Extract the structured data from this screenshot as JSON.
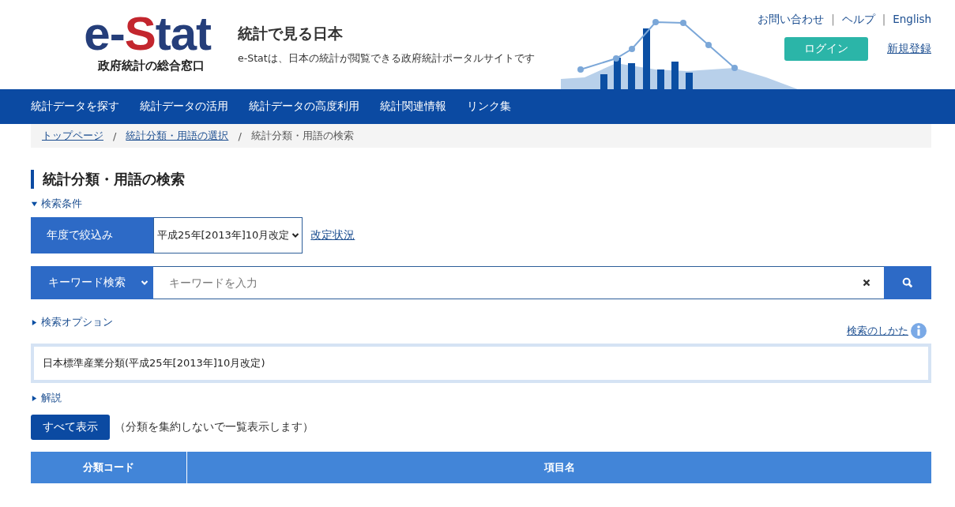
{
  "header": {
    "logo": {
      "text_primary": "e-",
      "text_accent": "S",
      "text_rest": "tat",
      "subtitle": "政府統計の総合窓口"
    },
    "tagline_title": "統計で見る日本",
    "tagline": "e-Statは、日本の統計が閲覧できる政府統計ポータルサイトです",
    "utility_links": [
      "お問い合わせ",
      "ヘルプ",
      "English"
    ],
    "utility_separator": "|",
    "login_button": "ログイン",
    "register_link": "新規登録"
  },
  "nav": [
    {
      "label": "統計データを探す"
    },
    {
      "label": "統計データの活用"
    },
    {
      "label": "統計データの高度利用"
    },
    {
      "label": "統計関連情報"
    },
    {
      "label": "リンク集"
    }
  ],
  "breadcrumb": [
    {
      "label": "トップページ",
      "link": true
    },
    {
      "label": "統計分類・用語の選択",
      "link": true
    },
    {
      "label": "統計分類・用語の検索",
      "link": false
    }
  ],
  "breadcrumb_separator": "/",
  "page_title": "統計分類・用語の検索",
  "search_conditions": {
    "label": "検索条件",
    "expanded": true
  },
  "year_filter": {
    "label": "年度で絞込み",
    "value": "平成25年[2013年]10月改定",
    "link": "改定状況"
  },
  "keyword_search": {
    "mode": "キーワード検索",
    "placeholder": "キーワードを入力"
  },
  "search_options": {
    "label": "検索オプション",
    "expanded": false
  },
  "search_help_link": "検索のしかた",
  "classification": "日本標準産業分類(平成25年[2013年]10月改定)",
  "explanation": {
    "label": "解説",
    "expanded": false
  },
  "show_all": {
    "button": "すべて表示",
    "note": "（分類を集約しないで一覧表示します）"
  },
  "table": {
    "columns": [
      "分類コード",
      "項目名"
    ]
  }
}
